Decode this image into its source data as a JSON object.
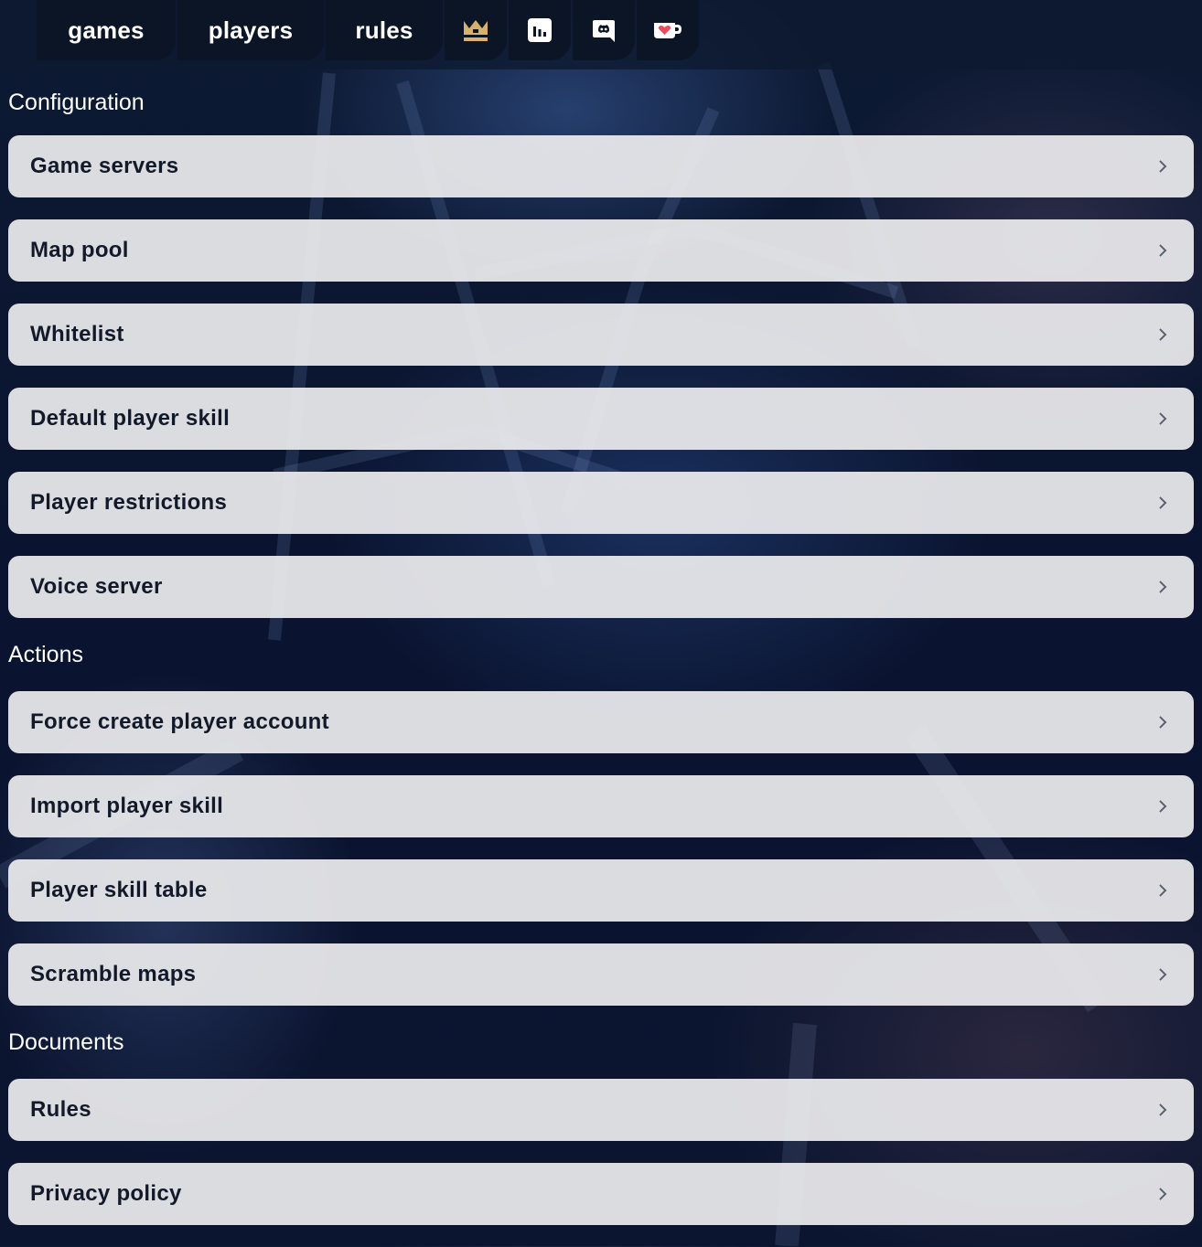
{
  "nav": {
    "items": [
      {
        "label": "games"
      },
      {
        "label": "players"
      },
      {
        "label": "rules"
      }
    ],
    "icons": [
      "crown-icon",
      "stats-icon",
      "discord-icon",
      "kofi-cup-icon"
    ]
  },
  "colors": {
    "crown": "#d8b26a",
    "heart": "#ef4b5d",
    "row_bg": "#ececee",
    "row_text": "#121a2a"
  },
  "sections": [
    {
      "title": "Configuration",
      "items": [
        {
          "label": "Game servers"
        },
        {
          "label": "Map pool"
        },
        {
          "label": "Whitelist"
        },
        {
          "label": "Default player skill"
        },
        {
          "label": "Player restrictions"
        },
        {
          "label": "Voice server"
        }
      ]
    },
    {
      "title": "Actions",
      "items": [
        {
          "label": "Force create player account"
        },
        {
          "label": "Import player skill"
        },
        {
          "label": "Player skill table"
        },
        {
          "label": "Scramble maps"
        }
      ]
    },
    {
      "title": "Documents",
      "items": [
        {
          "label": "Rules"
        },
        {
          "label": "Privacy policy"
        }
      ]
    }
  ]
}
